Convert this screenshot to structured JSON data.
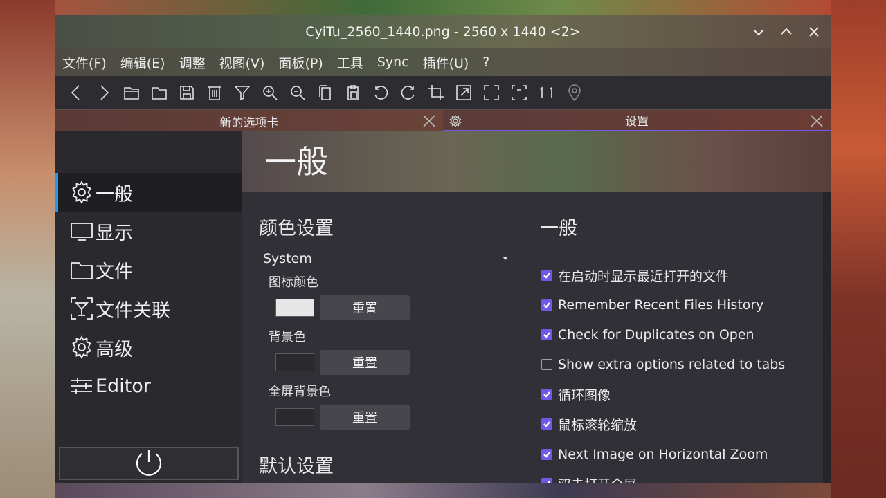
{
  "window": {
    "title": "CyiTu_2560_1440.png - 2560 x 1440 <2>"
  },
  "menu": [
    "文件(F)",
    "编辑(E)",
    "调整",
    "视图(V)",
    "面板(P)",
    "工具",
    "Sync",
    "插件(U)",
    "?"
  ],
  "toolbar_icons": [
    "arrow-left-icon",
    "arrow-right-icon",
    "open-tab-icon",
    "folder-icon",
    "save-icon",
    "delete-icon",
    "filter-icon",
    "zoom-in-icon",
    "zoom-out-icon",
    "copy-icon",
    "paste-icon",
    "rotate-left-icon",
    "rotate-right-icon",
    "crop-icon",
    "resize-icon",
    "fullscreen-icon",
    "fit-window-icon",
    "actual-size-icon",
    "location-pin-icon"
  ],
  "tabs": [
    {
      "label": "新的选项卡"
    },
    {
      "label": "设置"
    }
  ],
  "sidebar": {
    "items": [
      {
        "label": "一般",
        "icon": "gear-icon"
      },
      {
        "label": "显示",
        "icon": "monitor-icon"
      },
      {
        "label": "文件",
        "icon": "folder-icon"
      },
      {
        "label": "文件关联",
        "icon": "file-association-icon"
      },
      {
        "label": "高级",
        "icon": "gear-icon"
      },
      {
        "label": "Editor",
        "icon": "sliders-icon"
      }
    ]
  },
  "content": {
    "page_title": "一般",
    "color_section": {
      "title": "颜色设置",
      "theme_value": "System",
      "colors": [
        {
          "label": "图标颜色",
          "swatch": "#e6e6e6",
          "reset": "重置"
        },
        {
          "label": "背景色",
          "swatch": "#2a2a2d",
          "reset": "重置"
        },
        {
          "label": "全屏背景色",
          "swatch": "#2a2a2d",
          "reset": "重置"
        }
      ]
    },
    "defaults_section": {
      "title": "默认设置"
    },
    "general_section": {
      "title": "一般",
      "options": [
        {
          "label": "在启动时显示最近打开的文件",
          "checked": true
        },
        {
          "label": "Remember Recent Files History",
          "checked": true
        },
        {
          "label": "Check for Duplicates on Open",
          "checked": true
        },
        {
          "label": "Show extra options related to tabs",
          "checked": false
        },
        {
          "label": "循环图像",
          "checked": true
        },
        {
          "label": "鼠标滚轮缩放",
          "checked": true
        },
        {
          "label": "Next Image on Horizontal Zoom",
          "checked": true
        },
        {
          "label": "双击打开全屏",
          "checked": true
        }
      ]
    }
  },
  "colors": {
    "accent": "#6e5ae6",
    "active_indicator": "#1d9bf0"
  }
}
